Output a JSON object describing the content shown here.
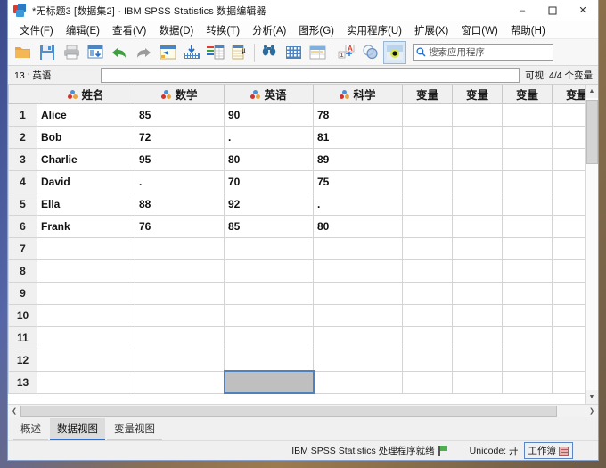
{
  "window": {
    "title": "*无标题3 [数据集2] - IBM SPSS Statistics 数据编辑器",
    "minimize": "–",
    "maximize": "☐",
    "close": "✕"
  },
  "menubar": {
    "items": [
      {
        "label": "文件(F)",
        "name": "menu-file"
      },
      {
        "label": "编辑(E)",
        "name": "menu-edit"
      },
      {
        "label": "查看(V)",
        "name": "menu-view"
      },
      {
        "label": "数据(D)",
        "name": "menu-data"
      },
      {
        "label": "转换(T)",
        "name": "menu-transform"
      },
      {
        "label": "分析(A)",
        "name": "menu-analyze"
      },
      {
        "label": "图形(G)",
        "name": "menu-graphs"
      },
      {
        "label": "实用程序(U)",
        "name": "menu-utilities"
      },
      {
        "label": "扩展(X)",
        "name": "menu-extensions"
      },
      {
        "label": "窗口(W)",
        "name": "menu-window"
      },
      {
        "label": "帮助(H)",
        "name": "menu-help"
      }
    ]
  },
  "toolbar": {
    "icons": [
      "open-file-icon",
      "save-file-icon",
      "print-icon",
      "recall-dialogs-icon",
      "undo-icon",
      "redo-icon",
      "goto-case-icon",
      "goto-variable-icon",
      "variables-icon",
      "descriptives-icon",
      "find-icon",
      "insert-case-icon",
      "insert-variable-icon",
      "split-file-icon",
      "weight-cases-icon",
      "select-cases-icon",
      "value-labels-icon"
    ],
    "search_placeholder": "搜索应用程序",
    "search_value": ""
  },
  "refbar": {
    "cell_reference": "13 : 英语",
    "cell_value": "",
    "variable_count": "可视: 4/4 个变量"
  },
  "grid": {
    "columns": [
      {
        "label": "姓名",
        "measure": "nominal",
        "is_placeholder": false
      },
      {
        "label": "数学",
        "measure": "nominal",
        "is_placeholder": false
      },
      {
        "label": "英语",
        "measure": "nominal",
        "is_placeholder": false
      },
      {
        "label": "科学",
        "measure": "nominal",
        "is_placeholder": false
      },
      {
        "label": "变量",
        "measure": "none",
        "is_placeholder": true
      },
      {
        "label": "变量",
        "measure": "none",
        "is_placeholder": true
      },
      {
        "label": "变量",
        "measure": "none",
        "is_placeholder": true
      },
      {
        "label": "变量",
        "measure": "none",
        "is_placeholder": true
      },
      {
        "label": "变量",
        "measure": "none",
        "is_placeholder": true
      }
    ],
    "rows": [
      {
        "num": "1",
        "cells": [
          "Alice",
          "85",
          "90",
          "78",
          "",
          "",
          "",
          "",
          ""
        ]
      },
      {
        "num": "2",
        "cells": [
          "Bob",
          "72",
          ".",
          "81",
          "",
          "",
          "",
          "",
          ""
        ]
      },
      {
        "num": "3",
        "cells": [
          "Charlie",
          "95",
          "80",
          "89",
          "",
          "",
          "",
          "",
          ""
        ]
      },
      {
        "num": "4",
        "cells": [
          "David",
          ".",
          "70",
          "75",
          "",
          "",
          "",
          "",
          ""
        ]
      },
      {
        "num": "5",
        "cells": [
          "Ella",
          "88",
          "92",
          ".",
          "",
          "",
          "",
          "",
          ""
        ]
      },
      {
        "num": "6",
        "cells": [
          "Frank",
          "76",
          "85",
          "80",
          "",
          "",
          "",
          "",
          ""
        ]
      },
      {
        "num": "7",
        "cells": [
          "",
          "",
          "",
          "",
          "",
          "",
          "",
          "",
          ""
        ]
      },
      {
        "num": "8",
        "cells": [
          "",
          "",
          "",
          "",
          "",
          "",
          "",
          "",
          ""
        ]
      },
      {
        "num": "9",
        "cells": [
          "",
          "",
          "",
          "",
          "",
          "",
          "",
          "",
          ""
        ]
      },
      {
        "num": "10",
        "cells": [
          "",
          "",
          "",
          "",
          "",
          "",
          "",
          "",
          ""
        ]
      },
      {
        "num": "11",
        "cells": [
          "",
          "",
          "",
          "",
          "",
          "",
          "",
          "",
          ""
        ]
      },
      {
        "num": "12",
        "cells": [
          "",
          "",
          "",
          "",
          "",
          "",
          "",
          "",
          ""
        ]
      },
      {
        "num": "13",
        "cells": [
          "",
          "",
          "",
          "",
          "",
          "",
          "",
          "",
          ""
        ]
      }
    ],
    "selected_cell": {
      "row": 12,
      "col": 2
    }
  },
  "tabs": [
    {
      "label": "概述",
      "active": false,
      "name": "tab-overview"
    },
    {
      "label": "数据视图",
      "active": true,
      "name": "tab-data-view"
    },
    {
      "label": "变量视图",
      "active": false,
      "name": "tab-variable-view"
    }
  ],
  "statusbar": {
    "processor": "IBM SPSS Statistics 处理程序就绪",
    "unicode": "Unicode: 开",
    "workbook": "工作簿"
  },
  "scroll": {
    "up_arrow": "▲",
    "down_arrow": "▼",
    "left_arrow": "❮",
    "right_arrow": "❯"
  },
  "colors": {
    "accent": "#2a6fc9",
    "selection_fill": "#bfbfbf",
    "selection_border": "#4f81bd",
    "header_bg": "#f0f0f0"
  }
}
